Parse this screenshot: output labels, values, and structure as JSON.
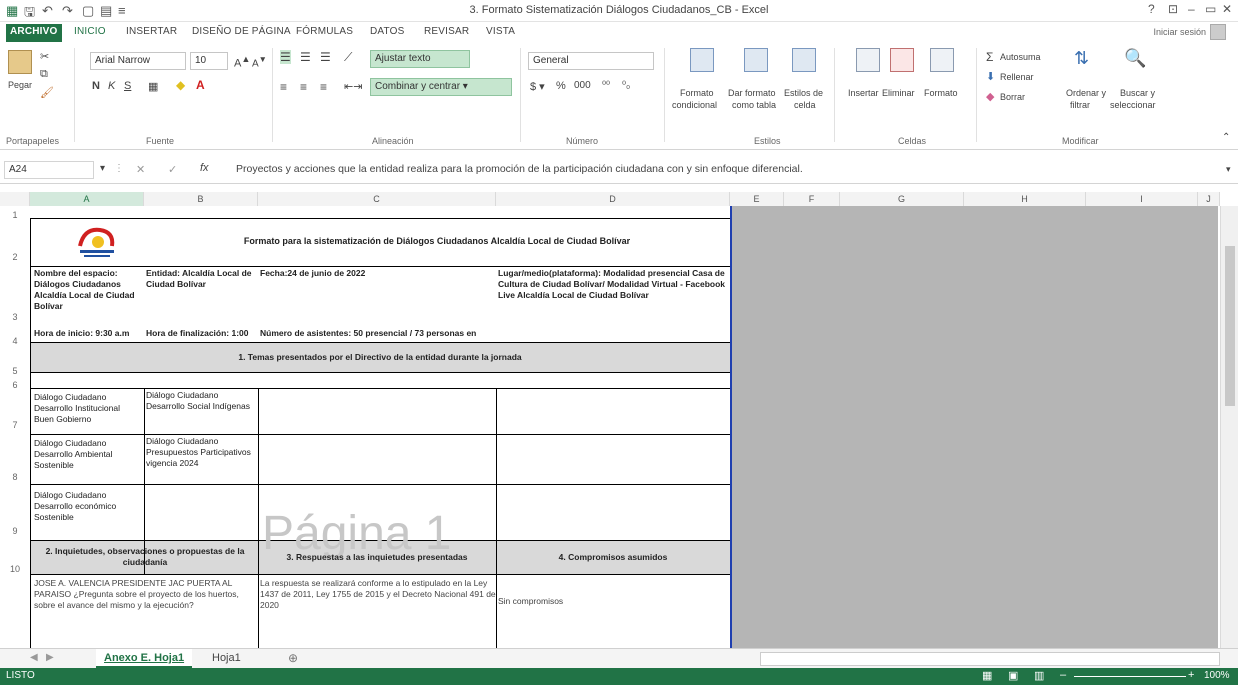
{
  "app": {
    "title": "3. Formato Sistematización Diálogos Ciudadanos_CB - Excel",
    "window_controls": [
      "?",
      "⊡",
      "–",
      "▭",
      "✕"
    ],
    "signin": "Iniciar sesión"
  },
  "tabs": [
    {
      "label": "ARCHIVO"
    },
    {
      "label": "INICIO"
    },
    {
      "label": "INSERTAR"
    },
    {
      "label": "DISEÑO DE PÁGINA"
    },
    {
      "label": "FÓRMULAS"
    },
    {
      "label": "DATOS"
    },
    {
      "label": "REVISAR"
    },
    {
      "label": "VISTA"
    }
  ],
  "ribbon": {
    "clipboard": {
      "paste": "Pegar",
      "label": "Portapapeles"
    },
    "font": {
      "name": "Arial Narrow",
      "size": "10",
      "label": "Fuente"
    },
    "alignment": {
      "wrap": "Ajustar texto",
      "merge": "Combinar y centrar",
      "label": "Alineación"
    },
    "number": {
      "format": "General",
      "label": "Número"
    },
    "styles": {
      "conditional": [
        "Formato",
        "condicional"
      ],
      "as_table": [
        "Dar formato",
        "como tabla"
      ],
      "cell_styles": [
        "Estilos de",
        "celda"
      ],
      "label": "Estilos"
    },
    "cells": {
      "insert": "Insertar",
      "delete": "Eliminar",
      "format": "Formato",
      "label": "Celdas"
    },
    "editing": {
      "autosum": "Autosuma",
      "fill": "Rellenar",
      "clear": "Borrar",
      "sort": [
        "Ordenar y",
        "filtrar"
      ],
      "find": [
        "Buscar y",
        "seleccionar"
      ],
      "label": "Modificar"
    }
  },
  "formula_bar": {
    "cell_ref": "A24",
    "content": "Proyectos y acciones que la entidad realiza para la promoción de la participación ciudadana con y sin enfoque diferencial."
  },
  "grid": {
    "columns": [
      "A",
      "B",
      "C",
      "D",
      "E",
      "F",
      "G",
      "H",
      "I",
      "J"
    ],
    "rows": [
      "1",
      "2",
      "3",
      "4",
      "5",
      "6",
      "7",
      "8",
      "9",
      "10"
    ],
    "header_title": "Formato para la sistematización de Diálogos Ciudadanos Alcaldía Local de Ciudad Bolívar",
    "row3": {
      "a": "Nombre del espacio: Diálogos Ciudadanos Alcaldía Local de Ciudad Bolívar",
      "b": "Entidad: Alcaldía Local de Ciudad Bolívar",
      "c": "Fecha:24 de junio de 2022",
      "d": "Lugar/medio(plataforma): Modalidad presencial Casa de Cultura de Ciudad Bolívar/ Modalidad Virtual - Facebook Live Alcaldía Local de Ciudad Bolívar"
    },
    "row4": {
      "a": "Hora de inicio: 9:30 a.m",
      "b": "Hora de finalización: 1:00",
      "c": "Número de asistentes: 50 presencial / 73 personas en"
    },
    "section1": "1. Temas presentados por el Directivo de la entidad durante la jornada",
    "row7": {
      "a": "Diálogo Ciudadano Desarrollo Institucional Buen Gobierno",
      "b": "Diálogo Ciudadano Desarrollo Social Indígenas"
    },
    "row8": {
      "a": "Diálogo Ciudadano Desarrollo Ambiental Sostenible",
      "b": "Diálogo Ciudadano Presupuestos Participativos vigencia 2024"
    },
    "row9": {
      "a": "Diálogo Ciudadano Desarrollo económico Sostenible"
    },
    "section2": {
      "a": "2. Inquietudes, observaciones o propuestas de la ciudadanía",
      "c": "3. Respuestas a las inquietudes presentadas",
      "d": "4. Compromisos asumidos"
    },
    "row11": {
      "a": "JOSE A. VALENCIA PRESIDENTE JAC PUERTA AL PARAISO ¿Pregunta sobre el proyecto de los huertos, sobre el avance del mismo y la ejecución?",
      "c": "La respuesta se realizará conforme a lo estipulado en la Ley 1437 de 2011, Ley 1755 de 2015 y el Decreto Nacional 491 de 2020",
      "d": "Sin compromisos"
    },
    "watermark": "Página 1"
  },
  "sheets": [
    {
      "label": "Anexo E. Hoja1",
      "active": true
    },
    {
      "label": "Hoja1",
      "active": false
    }
  ],
  "status": {
    "mode": "LISTO",
    "zoom": "100%"
  },
  "colors": {
    "accent": "#217346",
    "outside_print_area": "#b5b5b5",
    "section_band": "#d9d9d9",
    "print_area_border": "#1f3fb0"
  }
}
